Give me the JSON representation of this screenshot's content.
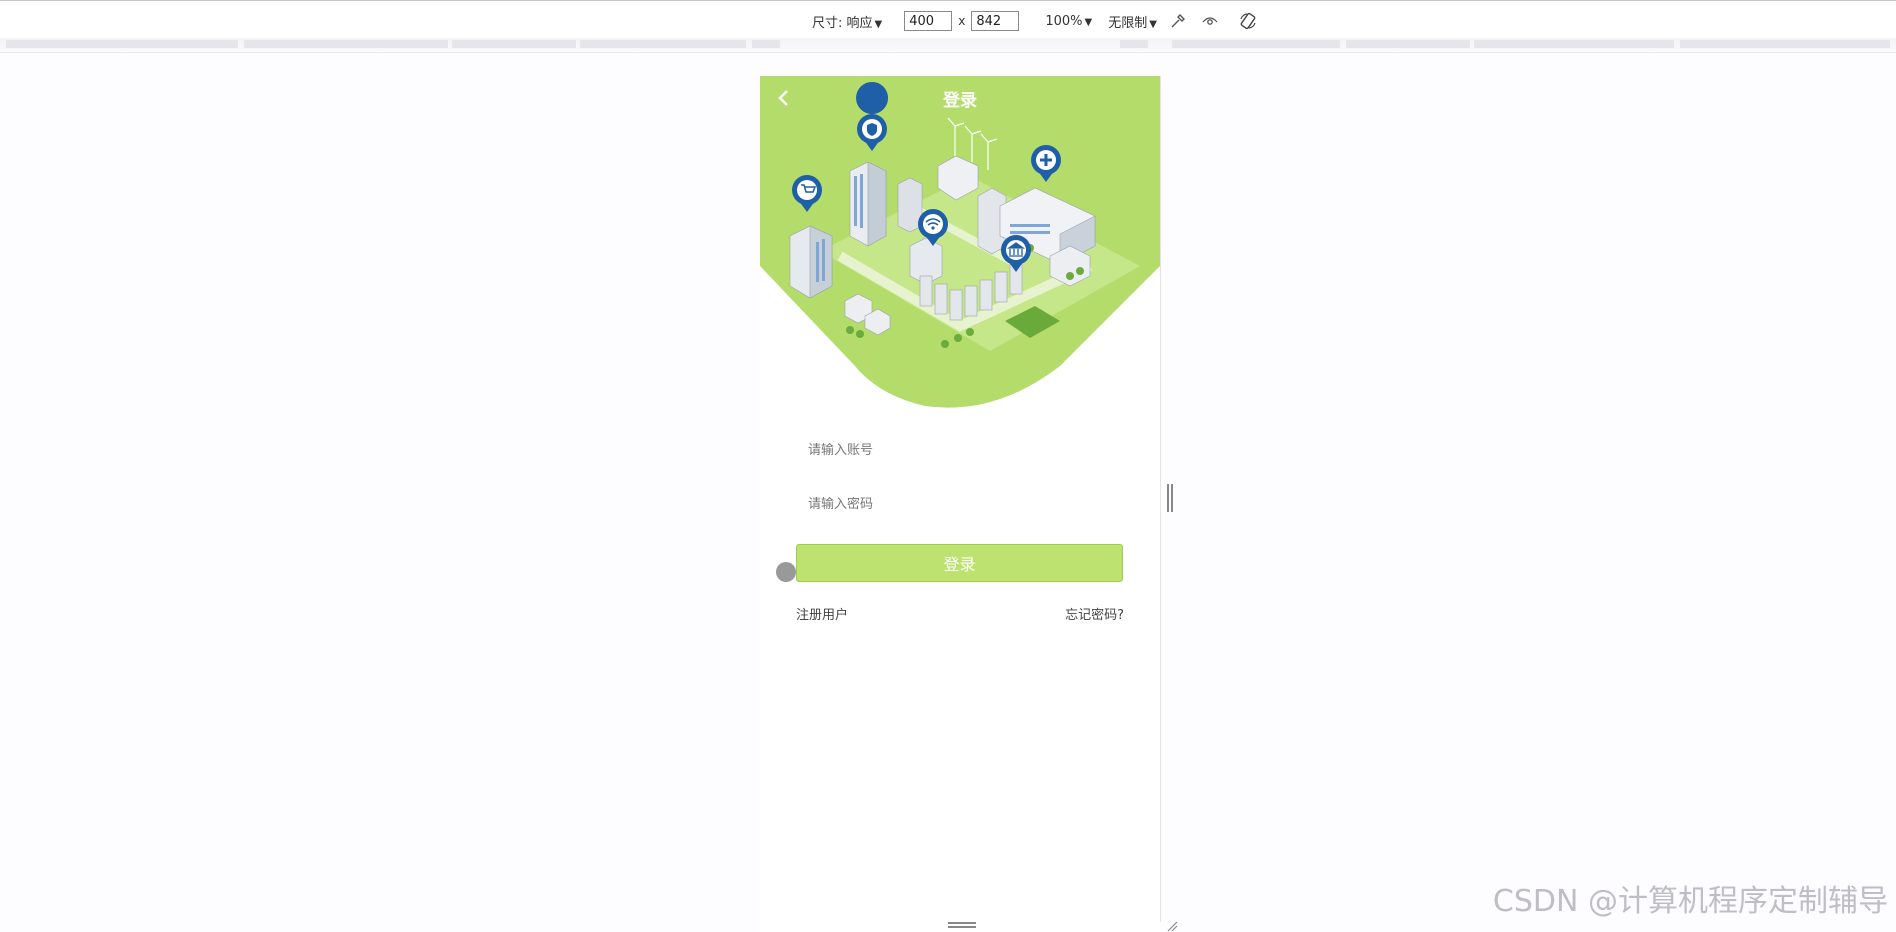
{
  "toolbar": {
    "size_label": "尺寸: 响应",
    "width_value": "400",
    "times": "x",
    "height_value": "842",
    "zoom": "100%",
    "throttle": "无限制",
    "icons": [
      "dropper-icon",
      "eye-icon",
      "rotate-icon"
    ]
  },
  "page": {
    "title": "登录",
    "account_placeholder": "请输入账号",
    "password_placeholder": "请输入密码",
    "login_button": "登录",
    "register_link": "注册用户",
    "forgot_link": "忘记密码?"
  },
  "watermark": "CSDN @计算机程序定制辅导",
  "colors": {
    "hero_green": "#b3dc6b",
    "button_green": "#bde26f",
    "pin_blue": "#1f5fa8"
  }
}
